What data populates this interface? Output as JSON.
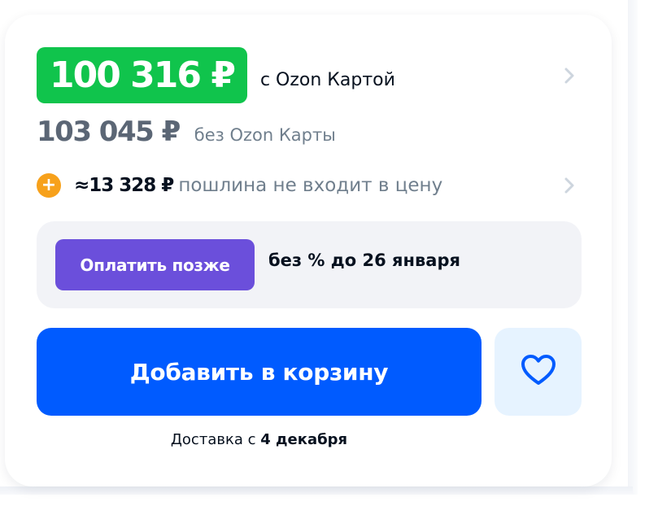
{
  "price": {
    "card_price": "100 316 ₽",
    "card_label": "с Ozon Картой",
    "regular_price": "103 045 ₽",
    "regular_label": "без Ozon Карты"
  },
  "duty": {
    "icon_symbol": "+",
    "amount": "≈13 328 ₽",
    "text": "пошлина не входит в цену"
  },
  "installment": {
    "button_label": "Оплатить позже",
    "text": "без % до 26 января"
  },
  "actions": {
    "add_to_cart_label": "Добавить в корзину",
    "favorite_icon": "heart-icon"
  },
  "delivery": {
    "prefix": "Доставка с ",
    "date": "4 декабря"
  },
  "colors": {
    "card_price_bg": "#10c44c",
    "card_price_text": "#ffffff",
    "accent_blue": "#005bff",
    "pay_later_purple": "#6b4fdb",
    "duty_icon_orange": "#f7a11b",
    "favorite_bg": "#e6f3ff",
    "chevron_gray": "#cdd5de"
  }
}
